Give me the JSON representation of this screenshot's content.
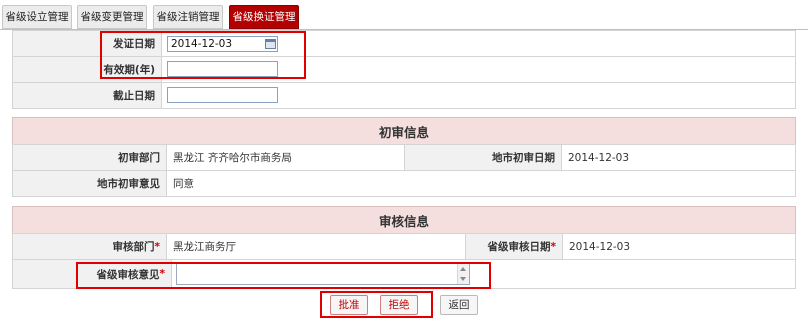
{
  "tabs": [
    {
      "label": "省级设立管理",
      "active": false
    },
    {
      "label": "省级变更管理",
      "active": false
    },
    {
      "label": "省级注销管理",
      "active": false
    },
    {
      "label": "省级换证管理",
      "active": true
    }
  ],
  "form": {
    "issue_date_label": "发证日期",
    "issue_date_value": "2014-12-03",
    "validity_label": "有效期(年)",
    "validity_value": "",
    "expiry_label": "截止日期",
    "expiry_value": ""
  },
  "initial_review": {
    "title": "初审信息",
    "dept_label": "初审部门",
    "dept_value": "黑龙江 齐齐哈尔市商务局",
    "date_label": "地市初审日期",
    "date_value": "2014-12-03",
    "opinion_label": "地市初审意见",
    "opinion_value": "同意"
  },
  "audit": {
    "title": "审核信息",
    "dept_label": "审核部门",
    "dept_value": "黑龙江商务厅",
    "date_label": "省级审核日期",
    "date_value": "2014-12-03",
    "opinion_label": "省级审核意见",
    "opinion_value": "",
    "required_mark": "*"
  },
  "buttons": {
    "approve": "批准",
    "reject": "拒绝",
    "back": "返回"
  },
  "colors": {
    "accent": "#b30000",
    "highlight": "#e00000",
    "section_bg": "#f4dede"
  }
}
